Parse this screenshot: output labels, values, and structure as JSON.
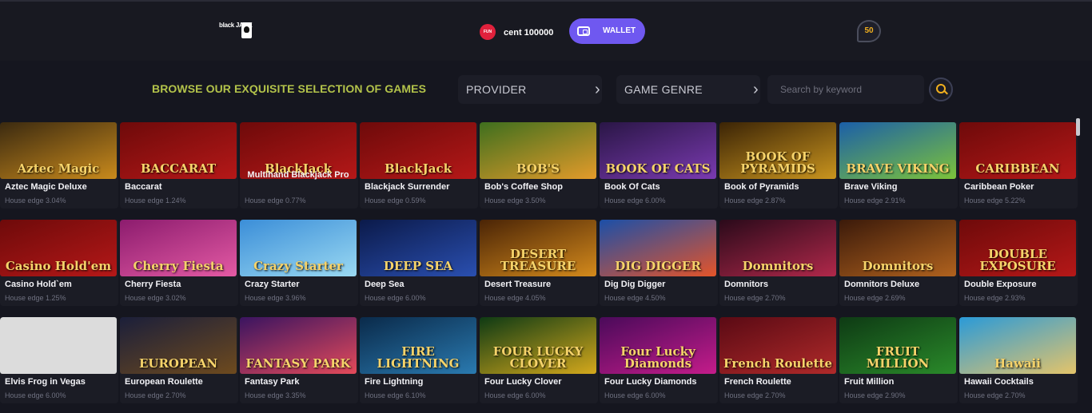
{
  "header": {
    "logo": "black JACK",
    "fun_badge": "FUN",
    "balance": "cent 100000",
    "wallet_label": "WALLET",
    "level": "50"
  },
  "browse": {
    "title": "BROWSE OUR EXQUISITE SELECTION OF GAMES",
    "provider_label": "PROVIDER",
    "genre_label": "GAME GENRE",
    "search_placeholder": "Search by keyword"
  },
  "games": [
    {
      "name": "Aztec Magic Deluxe",
      "edge": "House edge 3.04%",
      "art": "Aztec Magic",
      "colors": [
        "#3b2a10",
        "#c98a1c"
      ]
    },
    {
      "name": "Baccarat",
      "edge": "House edge 1.24%",
      "art": "BACCARAT",
      "colors": [
        "#6e0a0a",
        "#b51818"
      ]
    },
    {
      "name": "Multihand Blackjack Pro",
      "edge": "House edge 0.77%",
      "art": "BlackJack",
      "colors": [
        "#6e0a0a",
        "#b51818"
      ]
    },
    {
      "name": "Blackjack Surrender",
      "edge": "House edge 0.59%",
      "art": "BlackJack",
      "colors": [
        "#6e0a0a",
        "#b51818"
      ]
    },
    {
      "name": "Bob's Coffee Shop",
      "edge": "House edge 3.50%",
      "art": "BOB'S",
      "colors": [
        "#3e6f1e",
        "#e49b2a"
      ]
    },
    {
      "name": "Book Of Cats",
      "edge": "House edge 6.00%",
      "art": "BOOK OF CATS",
      "colors": [
        "#2a1646",
        "#7a3ab0"
      ]
    },
    {
      "name": "Book of Pyramids",
      "edge": "House edge 2.87%",
      "art": "BOOK OF PYRAMIDS",
      "colors": [
        "#3b2406",
        "#c9941e"
      ]
    },
    {
      "name": "Brave Viking",
      "edge": "House edge 2.91%",
      "art": "BRAVE VIKING",
      "colors": [
        "#1b5fa8",
        "#7cc33a"
      ]
    },
    {
      "name": "Caribbean Poker",
      "edge": "House edge 5.22%",
      "art": "CARIBBEAN",
      "colors": [
        "#6e0a0a",
        "#b51818"
      ]
    },
    {
      "name": "Casino Hold`em",
      "edge": "House edge 1.25%",
      "art": "Casino Hold'em",
      "colors": [
        "#6e0a0a",
        "#b51818"
      ]
    },
    {
      "name": "Cherry Fiesta",
      "edge": "House edge 3.02%",
      "art": "Cherry Fiesta",
      "colors": [
        "#8c1c6e",
        "#e45aa4"
      ]
    },
    {
      "name": "Crazy Starter",
      "edge": "House edge 3.96%",
      "art": "Crazy Starter",
      "colors": [
        "#3b8ed8",
        "#9ad9f2"
      ]
    },
    {
      "name": "Deep Sea",
      "edge": "House edge 6.00%",
      "art": "DEEP SEA",
      "colors": [
        "#0b1a4a",
        "#2a4fb0"
      ]
    },
    {
      "name": "Desert Treasure",
      "edge": "House edge 4.05%",
      "art": "DESERT TREASURE",
      "colors": [
        "#4a2406",
        "#d48a1c"
      ]
    },
    {
      "name": "Dig Dig Digger",
      "edge": "House edge 4.50%",
      "art": "DIG DIGGER",
      "colors": [
        "#1b4fa8",
        "#e4542a"
      ]
    },
    {
      "name": "Domnitors",
      "edge": "House edge 2.70%",
      "art": "Domnitors",
      "colors": [
        "#2a0a1a",
        "#b0284a"
      ]
    },
    {
      "name": "Domnitors Deluxe",
      "edge": "House edge 2.69%",
      "art": "Domnitors",
      "colors": [
        "#3b1a0a",
        "#b0621e"
      ]
    },
    {
      "name": "Double Exposure",
      "edge": "House edge 2.93%",
      "art": "DOUBLE EXPOSURE",
      "colors": [
        "#6e0a0a",
        "#b51818"
      ]
    },
    {
      "name": "Elvis Frog in Vegas",
      "edge": "House edge 6.00%",
      "art": "",
      "colors": [
        "#dcdcdc",
        "#dcdcdc"
      ]
    },
    {
      "name": "European Roulette",
      "edge": "House edge 2.70%",
      "art": "EUROPEAN",
      "colors": [
        "#1b1f3a",
        "#6e4a1e"
      ]
    },
    {
      "name": "Fantasy Park",
      "edge": "House edge 3.35%",
      "art": "FANTASY PARK",
      "colors": [
        "#3a1460",
        "#e44a5a"
      ]
    },
    {
      "name": "Fire Lightning",
      "edge": "House edge 6.10%",
      "art": "FIRE LIGHTNING",
      "colors": [
        "#0a2a4a",
        "#2a7ab0"
      ]
    },
    {
      "name": "Four Lucky Clover",
      "edge": "House edge 6.00%",
      "art": "FOUR LUCKY CLOVER",
      "colors": [
        "#0e3a14",
        "#d4a81c"
      ]
    },
    {
      "name": "Four Lucky Diamonds",
      "edge": "House edge 6.00%",
      "art": "Four Lucky Diamonds",
      "colors": [
        "#4a0a5a",
        "#c41c8a"
      ]
    },
    {
      "name": "French Roulette",
      "edge": "House edge 2.70%",
      "art": "French Roulette",
      "colors": [
        "#5a0a14",
        "#b02a2a"
      ]
    },
    {
      "name": "Fruit Million",
      "edge": "House edge 2.90%",
      "art": "FRUIT MILLION",
      "colors": [
        "#0e3a14",
        "#2a8a2a"
      ]
    },
    {
      "name": "Hawaii Cocktails",
      "edge": "House edge 2.70%",
      "art": "Hawaii",
      "colors": [
        "#2a9ad8",
        "#e4c46a"
      ]
    }
  ]
}
